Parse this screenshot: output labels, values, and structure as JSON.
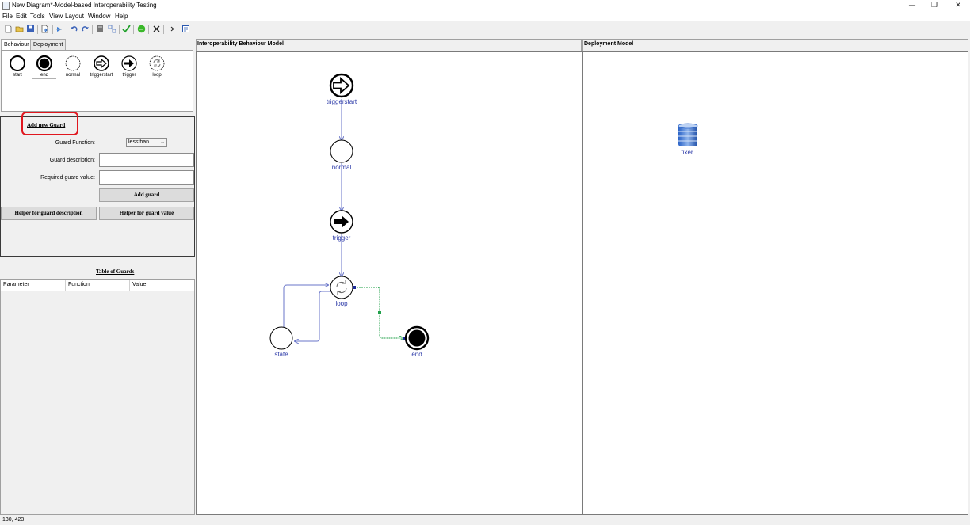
{
  "window": {
    "title": "New Diagram*-Model-based Interoperability Testing",
    "minimize": "—",
    "maximize": "❐",
    "close": "✕"
  },
  "menu": [
    "File",
    "Edit",
    "Tools",
    "View",
    "Layout",
    "Window",
    "Help"
  ],
  "toolbar_icons": [
    "new-file-icon",
    "open-folder-icon",
    "save-icon",
    "export-icon",
    "arrow-tool-icon",
    "undo-icon",
    "redo-icon",
    "database-icon",
    "layout-icon",
    "validate-check-icon",
    "run-icon",
    "delete-icon",
    "step-arrow-icon",
    "report-icon"
  ],
  "tabs": {
    "behaviour": "Behaviour",
    "deployment": "Deployment"
  },
  "palette": [
    {
      "label": "start",
      "icon": "start-circle-icon"
    },
    {
      "label": "end",
      "icon": "end-circle-icon"
    },
    {
      "label": "normal",
      "icon": "normal-circle-icon"
    },
    {
      "label": "triggerstart",
      "icon": "triggerstart-icon"
    },
    {
      "label": "trigger",
      "icon": "trigger-icon"
    },
    {
      "label": "loop",
      "icon": "loop-icon"
    }
  ],
  "guard_form": {
    "heading": "Add new Guard",
    "function_label": "Guard Function:",
    "function_value": "lessthan",
    "description_label": "Guard description:",
    "description_value": "",
    "required_label": "Required guard value:",
    "required_value": "",
    "add_button": "Add guard",
    "helper_description_button": "Helper for guard description",
    "helper_value_button": "Helper for guard value"
  },
  "guards_table": {
    "title": "Table of Guards",
    "columns": [
      "Parameter",
      "Function",
      "Value"
    ],
    "rows": []
  },
  "behaviour_model": {
    "title": "Interoperability Behaviour Model",
    "nodes": [
      {
        "id": "triggerstart",
        "label": "triggerstart",
        "type": "triggerstart"
      },
      {
        "id": "normal",
        "label": "normal",
        "type": "normal"
      },
      {
        "id": "trigger",
        "label": "trigger",
        "type": "trigger"
      },
      {
        "id": "loop",
        "label": "loop",
        "type": "loop"
      },
      {
        "id": "state",
        "label": "state",
        "type": "normal"
      },
      {
        "id": "end",
        "label": "end",
        "type": "end"
      }
    ],
    "edges": [
      {
        "from": "triggerstart",
        "to": "normal"
      },
      {
        "from": "normal",
        "to": "trigger"
      },
      {
        "from": "trigger",
        "to": "loop"
      },
      {
        "from": "loop",
        "to": "state"
      },
      {
        "from": "state",
        "to": "loop"
      },
      {
        "from": "loop",
        "to": "end",
        "selected": true
      }
    ]
  },
  "deployment_model": {
    "title": "Deployment Model",
    "nodes": [
      {
        "label": "fixer",
        "icon": "server-database-icon"
      }
    ]
  },
  "status": {
    "coordinates": "130, 423"
  },
  "colors": {
    "node_label": "#2c3aa8",
    "edge": "#6a76c8",
    "selected_edge": "#21a04a",
    "highlight": "#e0161e"
  }
}
